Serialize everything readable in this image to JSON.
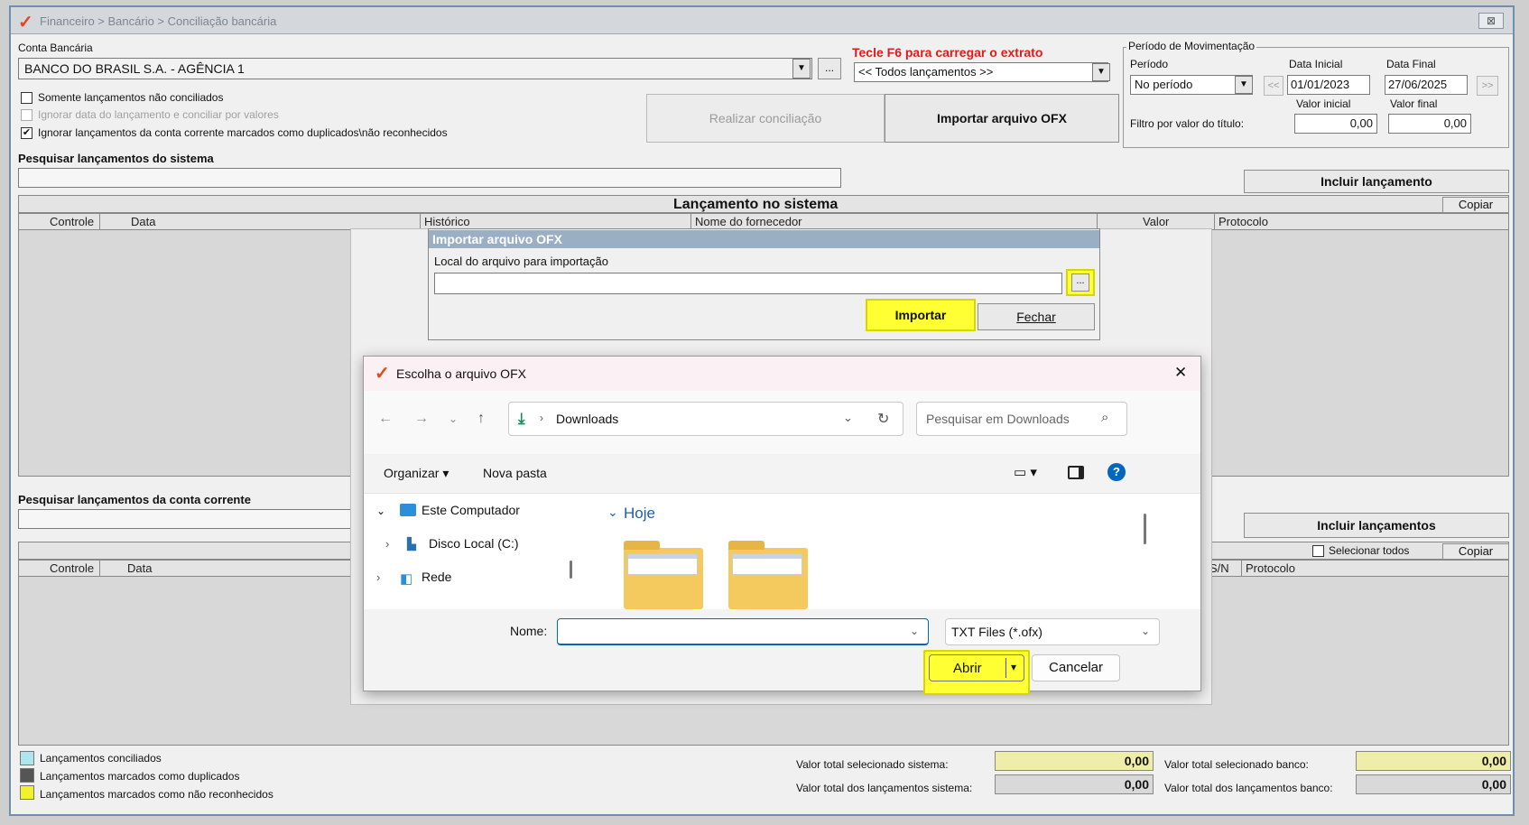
{
  "titlebar": {
    "path": "Financeiro > Bancário > Conciliação bancária",
    "close": "⊠"
  },
  "conta": {
    "label": "Conta Bancária",
    "value": "BANCO DO BRASIL S.A. - AGÊNCIA 1"
  },
  "f6_hint": "Tecle F6 para carregar o extrato",
  "filtro_lancamentos": "<< Todos lançamentos >>",
  "checks": [
    {
      "label": "Somente lançamentos não conciliados",
      "checked": false,
      "disabled": false
    },
    {
      "label": "Ignorar data do lançamento e conciliar por valores",
      "checked": false,
      "disabled": true
    },
    {
      "label": "Ignorar lançamentos da conta corrente marcados como duplicados\\não reconhecidos",
      "checked": true,
      "disabled": false
    }
  ],
  "buttons": {
    "realizar": "Realizar conciliação",
    "importar_ofx": "Importar arquivo OFX",
    "incluir_lancamento": "Incluir lançamento",
    "copiar": "Copiar",
    "incluir_lancamentos": "Incluir lançamentos",
    "copiar2": "Copiar",
    "dots": "..."
  },
  "periodo": {
    "group": "Período de Movimentação",
    "periodo_label": "Período",
    "periodo_value": "No período",
    "data_inicial_label": "Data Inicial",
    "data_inicial": "01/01/2023",
    "data_final_label": "Data Final",
    "data_final": "27/06/2025",
    "prev": "<<",
    "next": ">>",
    "valor_inicial_label": "Valor inicial",
    "valor_final_label": "Valor final",
    "filtro_label": "Filtro por valor do título:",
    "valor_inicial": "0,00",
    "valor_final": "0,00"
  },
  "sistema": {
    "search_label": "Pesquisar lançamentos do sistema",
    "grid_title": "Lançamento no sistema",
    "columns": [
      "Controle",
      "Data",
      "Histórico",
      "Nome do fornecedor",
      "Valor",
      "Protocolo"
    ]
  },
  "conta_corrente": {
    "search_label": "Pesquisar lançamentos da conta corrente",
    "selecionar_todos": "Selecionar todos",
    "columns": [
      "Controle",
      "Data",
      "S/N",
      "Protocolo"
    ]
  },
  "legend": [
    "Lançamentos conciliados",
    "Lançamentos marcados como duplicados",
    "Lançamentos marcados como não reconhecidos"
  ],
  "legend_colors": [
    "#aee6ee",
    "#555555",
    "#f2f22a"
  ],
  "totals": {
    "sel_sistema_label": "Valor total selecionado sistema:",
    "sel_sistema": "0,00",
    "sel_banco_label": "Valor total selecionado banco:",
    "sel_banco": "0,00",
    "tot_sistema_label": "Valor total dos lançamentos sistema:",
    "tot_sistema": "0,00",
    "tot_banco_label": "Valor total dos lançamentos banco:",
    "tot_banco": "0,00"
  },
  "ofx_dialog": {
    "title": "Importar arquivo OFX",
    "local_label": "Local do arquivo para importação",
    "local_value": "",
    "browse": "...",
    "importar": "Importar",
    "fechar": "Fechar"
  },
  "file_dialog": {
    "title": "Escolha o arquivo OFX",
    "close": "✕",
    "location": "Downloads",
    "search_placeholder": "Pesquisar em Downloads",
    "organizar": "Organizar",
    "nova_pasta": "Nova pasta",
    "tree": [
      "Este Computador",
      "Disco Local (C:)",
      "Rede"
    ],
    "group": "Hoje",
    "nome_label": "Nome:",
    "nome_value": "",
    "filetype": "TXT Files (*.ofx)",
    "abrir": "Abrir",
    "cancelar": "Cancelar",
    "help": "?"
  },
  "accent": {
    "highlight": "#ffff33",
    "win_blue": "#0067c0",
    "hint_red": "#e01b1b"
  }
}
